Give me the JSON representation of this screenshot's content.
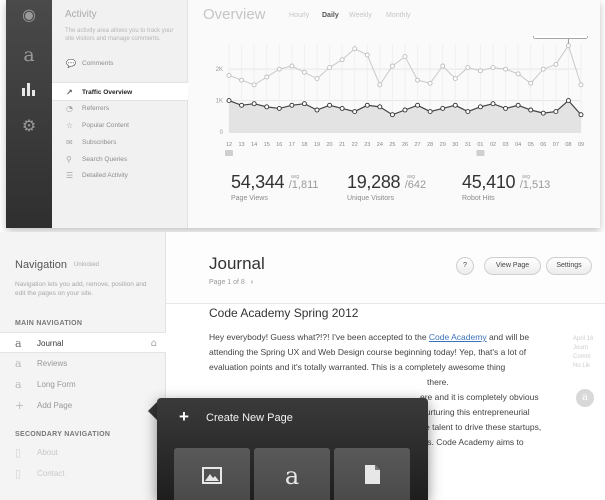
{
  "activity": {
    "title": "Activity",
    "description": "The activity area allows you to track your site visitors and manage comments.",
    "items": [
      {
        "label": "Comments",
        "icon": "comment-icon"
      },
      {
        "label": "Traffic Overview",
        "icon": "trend-icon",
        "selected": true
      },
      {
        "label": "Referrers",
        "icon": "pie-icon"
      },
      {
        "label": "Popular Content",
        "icon": "star-icon"
      },
      {
        "label": "Subscribers",
        "icon": "envelope-icon"
      },
      {
        "label": "Search Queries",
        "icon": "search-icon"
      },
      {
        "label": "Detailed Activity",
        "icon": "list-icon"
      }
    ]
  },
  "rail": {
    "icons": [
      "eye-icon",
      "logo-a-icon",
      "bar-chart-icon",
      "gear-icon"
    ]
  },
  "overview": {
    "title": "Overview",
    "ranges": [
      "Hourly",
      "Daily",
      "Weekly",
      "Monthly"
    ],
    "active_range": "Daily"
  },
  "chart_data": {
    "type": "line",
    "x": [
      "12",
      "13",
      "14",
      "15",
      "16",
      "17",
      "18",
      "19",
      "20",
      "21",
      "22",
      "23",
      "24",
      "25",
      "26",
      "27",
      "28",
      "29",
      "30",
      "31",
      "01",
      "02",
      "03",
      "04",
      "05",
      "06",
      "07",
      "08",
      "09"
    ],
    "y_ticks": [
      "2K",
      "1K",
      "0"
    ],
    "ylim": [
      0,
      2800
    ],
    "series": [
      {
        "values": [
          1800,
          1650,
          1500,
          1750,
          2000,
          2100,
          1900,
          1700,
          2050,
          2300,
          2650,
          2450,
          1500,
          2100,
          2400,
          1650,
          1550,
          2100,
          1700,
          2050,
          1950,
          2050,
          2000,
          1850,
          1550,
          2000,
          2150,
          2750,
          1500
        ]
      },
      {
        "values": [
          1000,
          850,
          900,
          800,
          750,
          850,
          900,
          700,
          850,
          750,
          650,
          850,
          800,
          550,
          700,
          850,
          650,
          750,
          850,
          650,
          800,
          900,
          750,
          850,
          700,
          600,
          650,
          1000,
          550
        ]
      }
    ],
    "tooltip": {
      "title": "2,750 Page Views",
      "sub": "09"
    },
    "grid": true
  },
  "stats": [
    {
      "value": "54,344",
      "avg_label": "avg",
      "avg": "/1,811",
      "label": "Page Views"
    },
    {
      "value": "19,288",
      "avg_label": "avg",
      "avg": "/642",
      "label": "Unique Visitors"
    },
    {
      "value": "45,410",
      "avg_label": "avg",
      "avg": "/1,513",
      "label": "Robot Hits"
    }
  ],
  "navigation": {
    "title": "Navigation",
    "status": "Unlocked",
    "description": "Navigation lets you add, remove, position and edit the pages on your site.",
    "main_label": "MAIN NAVIGATION",
    "main_items": [
      {
        "label": "Journal",
        "icon": "logo-a-icon",
        "selected": true
      },
      {
        "label": "Reviews",
        "icon": "logo-a-icon"
      },
      {
        "label": "Long Form",
        "icon": "logo-a-icon"
      },
      {
        "label": "Add Page",
        "icon": "plus-icon"
      }
    ],
    "secondary_label": "SECONDARY NAVIGATION",
    "secondary_items": [
      {
        "label": "About",
        "icon": "page-icon"
      },
      {
        "label": "Contact",
        "icon": "page-icon"
      }
    ]
  },
  "journal": {
    "title": "Journal",
    "page_info": "Page 1 of 8",
    "buttons": {
      "help": "?",
      "view": "View Page",
      "settings": "Settings"
    }
  },
  "article": {
    "title": "Code Academy Spring 2012",
    "p1": "Hey everybody! Guess what?!?! I've been accepted to the ",
    "link": "Code Academy",
    "p2": " and will be attending the Spring UX and Web Design course  beginning today! Yep, that's a lot of ",
    "l3": "evaluation points and it's totally warranted. This is a completely awesome thing",
    "l4": "there.",
    "l5": "ere and it is completely obvious",
    "l6": "nurturing this entrepreneurial",
    "l7": "e talent to drive these startups,",
    "l8": "ss. Code Academy aims to"
  },
  "side_meta": {
    "line1": "April 16",
    "line2": "Journ",
    "line3": "Comm",
    "line4": "No Lik"
  },
  "popover": {
    "plus": "+",
    "title": "Create New Page",
    "tiles": [
      "image-icon",
      "logo-a-icon",
      "page-icon"
    ]
  }
}
